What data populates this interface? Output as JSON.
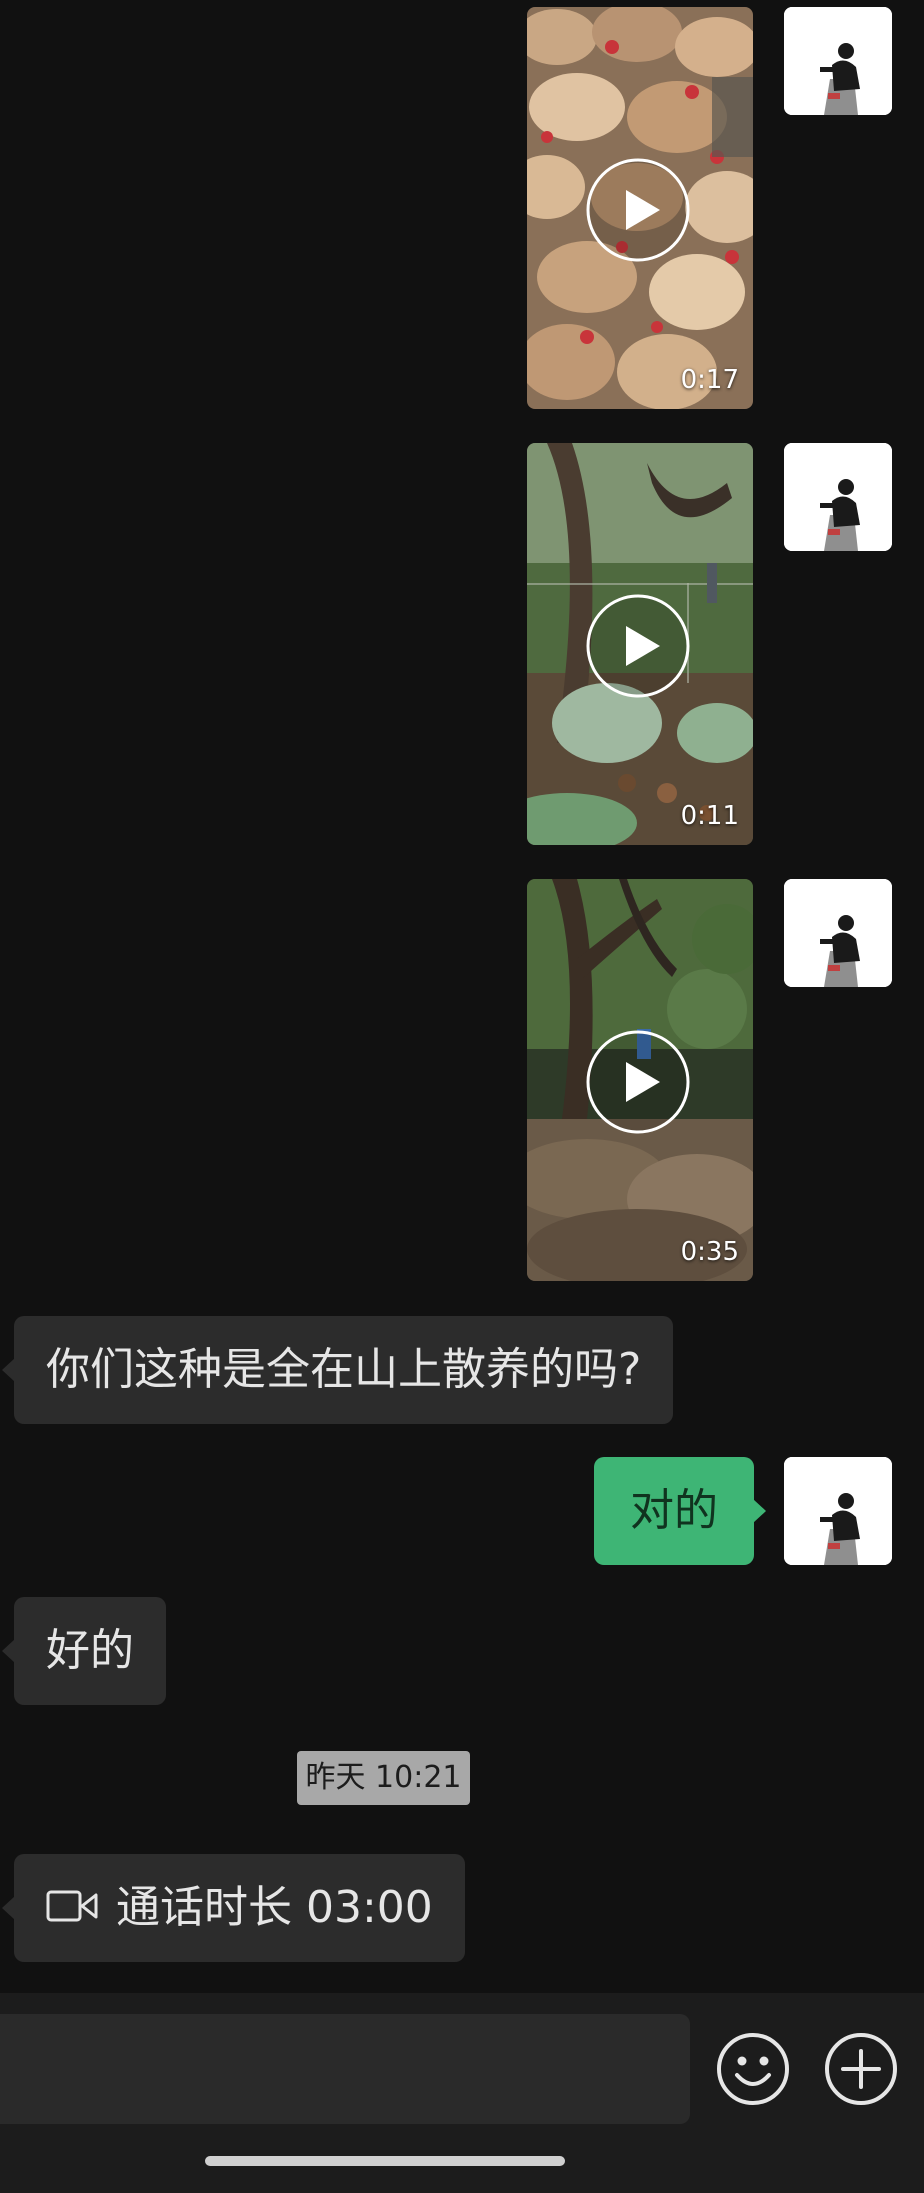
{
  "colors": {
    "background": "#111111",
    "bubble_in": "#2c2c2c",
    "bubble_out": "#3eb575",
    "timestamp_bg": "#a8a8a8"
  },
  "messages": [
    {
      "type": "video",
      "side": "right",
      "duration": "0:17",
      "thumbnail": "chickens-flock"
    },
    {
      "type": "video",
      "side": "right",
      "duration": "0:11",
      "thumbnail": "forest-with-fence"
    },
    {
      "type": "video",
      "side": "right",
      "duration": "0:35",
      "thumbnail": "tree-and-leaves"
    },
    {
      "type": "text",
      "side": "left",
      "text": "你们这种是全在山上散养的吗?"
    },
    {
      "type": "text",
      "side": "right",
      "text": "对的"
    },
    {
      "type": "text",
      "side": "left",
      "text": "好的"
    },
    {
      "type": "timestamp",
      "text": "昨天 10:21"
    },
    {
      "type": "call",
      "side": "left",
      "icon": "video-call-icon",
      "text": "通话时长 03:00"
    }
  ],
  "input_bar": {
    "message_value": "",
    "emoji_icon": "emoji-icon",
    "more_icon": "plus-circle-icon"
  }
}
